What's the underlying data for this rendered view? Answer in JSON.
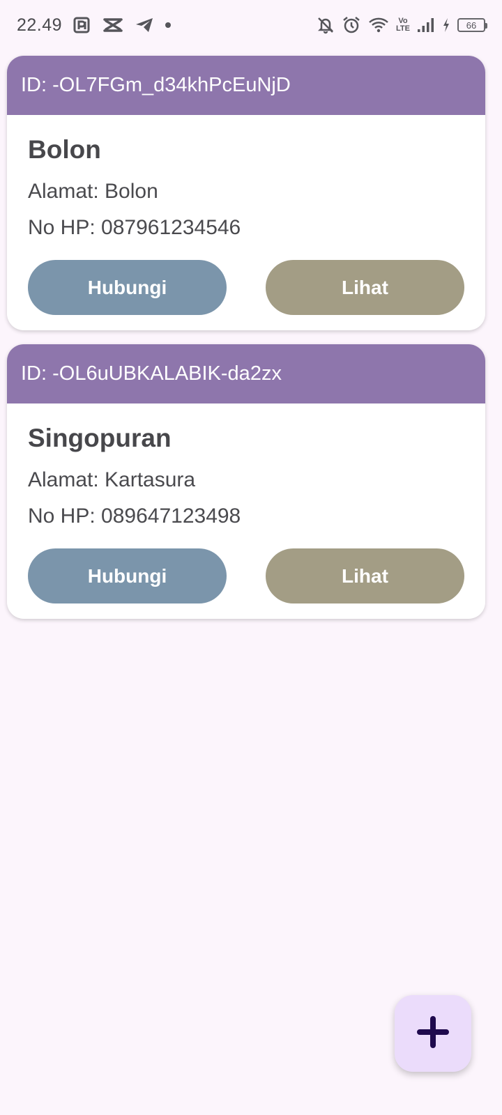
{
  "status_bar": {
    "time": "22.49",
    "battery_level": "66",
    "network_label_top": "Vo",
    "network_label_bottom": "LTE",
    "left_icons": [
      "parking-app-icon",
      "capcut-icon",
      "telegram-icon",
      "notification-dot"
    ],
    "right_icons": [
      "mute-notification-icon",
      "alarm-icon",
      "wifi-icon",
      "volte-icon",
      "signal-icon",
      "charging-icon",
      "battery-icon"
    ]
  },
  "contacts": [
    {
      "id_label": "ID: -OL7FGm_d34khPcEuNjD",
      "name": "Bolon",
      "address": "Alamat: Bolon",
      "phone": "No HP: 087961234546",
      "contact_button": "Hubungi",
      "view_button": "Lihat"
    },
    {
      "id_label": "ID: -OL6uUBKALABIK-da2zx",
      "name": "Singopuran",
      "address": "Alamat: Kartasura",
      "phone": "No HP: 089647123498",
      "contact_button": "Hubungi",
      "view_button": "Lihat"
    }
  ],
  "fab": {
    "icon": "plus-icon"
  },
  "colors": {
    "background": "#fcf5fc",
    "card_header": "#8e76ac",
    "contact_button": "#7b95ab",
    "view_button": "#a39d85",
    "fab_background": "#ebdcfb",
    "fab_icon": "#1f0a4d"
  }
}
